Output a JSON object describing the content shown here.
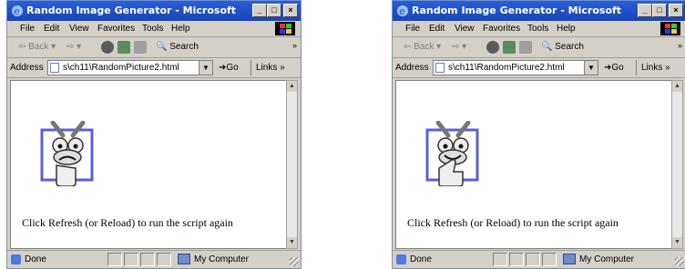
{
  "windows": [
    {
      "title": "Random Image Generator - Microsoft Intern...",
      "menu": [
        "File",
        "Edit",
        "View",
        "Favorites",
        "Tools",
        "Help"
      ],
      "toolbar": {
        "back": "Back",
        "search": "Search"
      },
      "address": {
        "label": "Address",
        "value": "s\\ch11\\RandomPicture2.html",
        "go": "Go",
        "links": "Links"
      },
      "content": {
        "image": "bug-thumbs-down",
        "message": "Click Refresh (or Reload) to run the script again"
      },
      "status": {
        "left": "Done",
        "zone": "My Computer"
      }
    },
    {
      "title": "Random Image Generator - Microsoft Intern...",
      "menu": [
        "File",
        "Edit",
        "View",
        "Favorites",
        "Tools",
        "Help"
      ],
      "toolbar": {
        "back": "Back",
        "search": "Search"
      },
      "address": {
        "label": "Address",
        "value": "s\\ch11\\RandomPicture2.html",
        "go": "Go",
        "links": "Links"
      },
      "content": {
        "image": "bug-thumbs-up",
        "message": "Click Refresh (or Reload) to run the script again"
      },
      "status": {
        "left": "Done",
        "zone": "My Computer"
      }
    }
  ],
  "titlebar_buttons": {
    "minimize": "_",
    "maximize": "□",
    "close": "×"
  },
  "chevron": "»",
  "colors": {
    "titlebar": "#1f4fc7",
    "chrome": "#d4d0c8",
    "content": "#ffffff",
    "picture_frame": "#5060d8"
  }
}
